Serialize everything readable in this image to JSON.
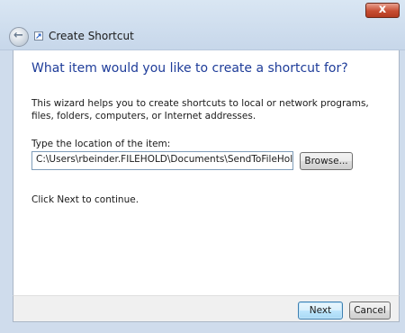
{
  "window": {
    "title": "Create Shortcut",
    "close_label": "x"
  },
  "wizard": {
    "heading": "What item would you like to create a shortcut for?",
    "description": "This wizard helps you to create shortcuts to local or network programs, files, folders, computers, or Internet addresses.",
    "location_label": "Type the location of the item:",
    "location_value": "C:\\Users\\rbeinder.FILEHOLD\\Documents\\SendToFileHold",
    "browse_label": "Browse...",
    "continue_text": "Click Next to continue."
  },
  "footer": {
    "next_label": "Next",
    "cancel_label": "Cancel"
  },
  "colors": {
    "heading": "#1e3c99",
    "frame": "#cfdcec",
    "close_button": "#c74d32"
  },
  "icons": {
    "back": "back-arrow-icon",
    "app": "shortcut-icon",
    "close": "close-icon"
  }
}
